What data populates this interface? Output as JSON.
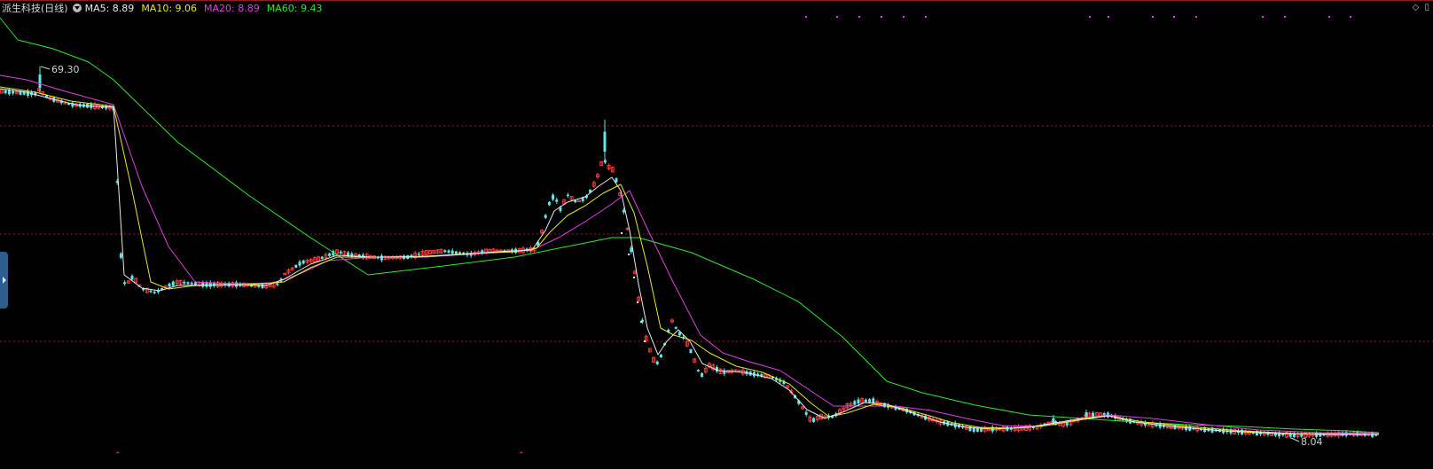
{
  "header": {
    "title": "派生科技(日线)",
    "ma_labels": [
      {
        "text": "MA5: 8.89",
        "color": "#e8e8e8"
      },
      {
        "text": "MA10: 9.06",
        "color": "#e6e62e"
      },
      {
        "text": "MA20: 8.89",
        "color": "#e040e0"
      },
      {
        "text": "MA60: 9.43",
        "color": "#2ee82e"
      }
    ],
    "icons": [
      "chevron-down-icon",
      "diamond-icon",
      "window-icon"
    ]
  },
  "chart_data": {
    "type": "candlestick",
    "annotations": {
      "high_label": "69.30",
      "low_label": "8.04"
    },
    "ylim": [
      0,
      100
    ],
    "colors": {
      "up": "#ff3b3b",
      "down": "#5fe6ea",
      "ma5": "#e8e8e8",
      "ma10": "#e6e62e",
      "ma20": "#e040e0",
      "ma60": "#2ee82e",
      "grid": "#8a1f1f"
    },
    "grid_y": [
      142,
      264,
      385
    ],
    "price_path": [
      [
        0,
        103
      ],
      [
        40,
        106
      ],
      [
        45,
        100
      ],
      [
        50,
        108
      ],
      [
        60,
        112
      ],
      [
        80,
        118
      ],
      [
        110,
        120
      ],
      [
        128,
        122
      ],
      [
        138,
        320
      ],
      [
        145,
        318
      ],
      [
        150,
        312
      ],
      [
        160,
        326
      ],
      [
        175,
        330
      ],
      [
        190,
        322
      ],
      [
        200,
        318
      ],
      [
        230,
        321
      ],
      [
        270,
        321
      ],
      [
        300,
        323
      ],
      [
        315,
        320
      ],
      [
        320,
        310
      ],
      [
        340,
        296
      ],
      [
        360,
        292
      ],
      [
        380,
        284
      ],
      [
        400,
        288
      ],
      [
        430,
        291
      ],
      [
        460,
        290
      ],
      [
        480,
        285
      ],
      [
        500,
        283
      ],
      [
        530,
        287
      ],
      [
        550,
        283
      ],
      [
        580,
        283
      ],
      [
        605,
        281
      ],
      [
        612,
        258
      ],
      [
        618,
        232
      ],
      [
        625,
        220
      ],
      [
        632,
        236
      ],
      [
        640,
        220
      ],
      [
        650,
        228
      ],
      [
        660,
        224
      ],
      [
        668,
        212
      ],
      [
        675,
        196
      ],
      [
        680,
        178
      ],
      [
        686,
        188
      ],
      [
        692,
        192
      ],
      [
        700,
        222
      ],
      [
        708,
        260
      ],
      [
        715,
        300
      ],
      [
        722,
        350
      ],
      [
        728,
        380
      ],
      [
        736,
        405
      ],
      [
        742,
        410
      ],
      [
        748,
        395
      ],
      [
        752,
        378
      ],
      [
        758,
        362
      ],
      [
        765,
        375
      ],
      [
        772,
        382
      ],
      [
        780,
        398
      ],
      [
        790,
        425
      ],
      [
        800,
        412
      ],
      [
        815,
        420
      ],
      [
        830,
        418
      ],
      [
        850,
        422
      ],
      [
        870,
        425
      ],
      [
        885,
        432
      ],
      [
        895,
        445
      ],
      [
        905,
        460
      ],
      [
        915,
        475
      ],
      [
        925,
        470
      ],
      [
        940,
        470
      ],
      [
        955,
        458
      ],
      [
        970,
        452
      ],
      [
        985,
        452
      ],
      [
        1000,
        458
      ],
      [
        1020,
        462
      ],
      [
        1040,
        470
      ],
      [
        1060,
        476
      ],
      [
        1080,
        480
      ],
      [
        1100,
        485
      ],
      [
        1120,
        484
      ],
      [
        1150,
        483
      ],
      [
        1170,
        482
      ],
      [
        1185,
        476
      ],
      [
        1200,
        479
      ],
      [
        1215,
        474
      ],
      [
        1230,
        468
      ],
      [
        1250,
        468
      ],
      [
        1270,
        474
      ],
      [
        1290,
        478
      ],
      [
        1320,
        481
      ],
      [
        1350,
        484
      ],
      [
        1380,
        486
      ],
      [
        1410,
        488
      ],
      [
        1440,
        490
      ],
      [
        1470,
        491
      ],
      [
        1500,
        490
      ],
      [
        1530,
        489
      ],
      [
        1555,
        491
      ]
    ],
    "spikes": [
      [
        45,
        75,
        105
      ],
      [
        682,
        135,
        180
      ],
      [
        128,
        118,
        126
      ],
      [
        1188,
        468,
        480
      ],
      [
        1225,
        462,
        472
      ]
    ],
    "ma_paths": {
      "ma5": [
        [
          0,
          100
        ],
        [
          30,
          104
        ],
        [
          60,
          112
        ],
        [
          90,
          119
        ],
        [
          128,
          121
        ],
        [
          140,
          310
        ],
        [
          160,
          325
        ],
        [
          180,
          328
        ],
        [
          200,
          322
        ],
        [
          260,
          321
        ],
        [
          300,
          322
        ],
        [
          320,
          315
        ],
        [
          350,
          298
        ],
        [
          380,
          288
        ],
        [
          420,
          290
        ],
        [
          470,
          290
        ],
        [
          520,
          287
        ],
        [
          560,
          284
        ],
        [
          600,
          282
        ],
        [
          615,
          260
        ],
        [
          625,
          238
        ],
        [
          640,
          228
        ],
        [
          660,
          222
        ],
        [
          675,
          210
        ],
        [
          690,
          200
        ],
        [
          700,
          215
        ],
        [
          710,
          260
        ],
        [
          720,
          320
        ],
        [
          730,
          370
        ],
        [
          742,
          400
        ],
        [
          752,
          385
        ],
        [
          765,
          372
        ],
        [
          778,
          385
        ],
        [
          792,
          410
        ],
        [
          810,
          418
        ],
        [
          840,
          420
        ],
        [
          870,
          427
        ],
        [
          890,
          440
        ],
        [
          910,
          462
        ],
        [
          930,
          472
        ],
        [
          950,
          465
        ],
        [
          975,
          454
        ],
        [
          1000,
          456
        ],
        [
          1030,
          466
        ],
        [
          1060,
          476
        ],
        [
          1090,
          482
        ],
        [
          1120,
          484
        ],
        [
          1160,
          482
        ],
        [
          1190,
          477
        ],
        [
          1220,
          472
        ],
        [
          1250,
          469
        ],
        [
          1280,
          476
        ],
        [
          1320,
          481
        ],
        [
          1380,
          486
        ],
        [
          1440,
          489
        ],
        [
          1500,
          490
        ],
        [
          1555,
          490
        ]
      ],
      "ma10": [
        [
          0,
          98
        ],
        [
          40,
          104
        ],
        [
          80,
          114
        ],
        [
          128,
          120
        ],
        [
          150,
          220
        ],
        [
          170,
          318
        ],
        [
          190,
          326
        ],
        [
          220,
          322
        ],
        [
          280,
          321
        ],
        [
          320,
          318
        ],
        [
          350,
          302
        ],
        [
          380,
          290
        ],
        [
          430,
          290
        ],
        [
          480,
          289
        ],
        [
          530,
          286
        ],
        [
          580,
          284
        ],
        [
          605,
          280
        ],
        [
          620,
          262
        ],
        [
          640,
          243
        ],
        [
          660,
          232
        ],
        [
          680,
          218
        ],
        [
          700,
          208
        ],
        [
          715,
          240
        ],
        [
          730,
          300
        ],
        [
          745,
          370
        ],
        [
          760,
          378
        ],
        [
          780,
          384
        ],
        [
          800,
          398
        ],
        [
          830,
          413
        ],
        [
          860,
          420
        ],
        [
          890,
          433
        ],
        [
          915,
          455
        ],
        [
          935,
          470
        ],
        [
          955,
          466
        ],
        [
          985,
          456
        ],
        [
          1015,
          460
        ],
        [
          1045,
          468
        ],
        [
          1075,
          477
        ],
        [
          1105,
          482
        ],
        [
          1140,
          483
        ],
        [
          1180,
          480
        ],
        [
          1215,
          474
        ],
        [
          1250,
          469
        ],
        [
          1290,
          476
        ],
        [
          1340,
          481
        ],
        [
          1400,
          486
        ],
        [
          1460,
          489
        ],
        [
          1555,
          490
        ]
      ],
      "ma20": [
        [
          0,
          85
        ],
        [
          30,
          90
        ],
        [
          70,
          102
        ],
        [
          128,
          118
        ],
        [
          160,
          210
        ],
        [
          190,
          278
        ],
        [
          220,
          318
        ],
        [
          260,
          320
        ],
        [
          310,
          319
        ],
        [
          340,
          308
        ],
        [
          370,
          294
        ],
        [
          420,
          290
        ],
        [
          480,
          290
        ],
        [
          540,
          286
        ],
        [
          600,
          282
        ],
        [
          630,
          268
        ],
        [
          660,
          250
        ],
        [
          690,
          230
        ],
        [
          710,
          215
        ],
        [
          730,
          258
        ],
        [
          760,
          320
        ],
        [
          790,
          378
        ],
        [
          815,
          398
        ],
        [
          845,
          408
        ],
        [
          880,
          418
        ],
        [
          910,
          438
        ],
        [
          940,
          458
        ],
        [
          970,
          458
        ],
        [
          1010,
          458
        ],
        [
          1050,
          463
        ],
        [
          1090,
          472
        ],
        [
          1130,
          480
        ],
        [
          1170,
          481
        ],
        [
          1210,
          474
        ],
        [
          1250,
          468
        ],
        [
          1300,
          472
        ],
        [
          1360,
          479
        ],
        [
          1420,
          485
        ],
        [
          1490,
          488
        ],
        [
          1555,
          489
        ]
      ],
      "ma60": [
        [
          0,
          20
        ],
        [
          20,
          45
        ],
        [
          60,
          55
        ],
        [
          100,
          70
        ],
        [
          128,
          90
        ],
        [
          200,
          160
        ],
        [
          280,
          220
        ],
        [
          350,
          268
        ],
        [
          415,
          310
        ],
        [
          500,
          300
        ],
        [
          580,
          290
        ],
        [
          640,
          278
        ],
        [
          690,
          268
        ],
        [
          720,
          268
        ],
        [
          780,
          285
        ],
        [
          850,
          315
        ],
        [
          900,
          340
        ],
        [
          950,
          380
        ],
        [
          1000,
          430
        ],
        [
          1040,
          443
        ],
        [
          1100,
          457
        ],
        [
          1160,
          468
        ],
        [
          1220,
          472
        ],
        [
          1280,
          476
        ],
        [
          1340,
          479
        ],
        [
          1400,
          481
        ],
        [
          1460,
          484
        ],
        [
          1520,
          486
        ],
        [
          1555,
          488
        ]
      ]
    },
    "top_marks": [
      908,
      943,
      968,
      993,
      1018,
      1043,
      1228,
      1249,
      1299,
      1323,
      1348,
      1423,
      1448,
      1498,
      1522
    ],
    "bottom_marks": [
      132,
      587
    ],
    "dots_descend": [
      [
        700,
        262
      ],
      [
        708,
        286
      ],
      [
        714,
        312
      ],
      [
        718,
        340
      ],
      [
        722,
        362
      ],
      [
        726,
        384
      ]
    ]
  }
}
